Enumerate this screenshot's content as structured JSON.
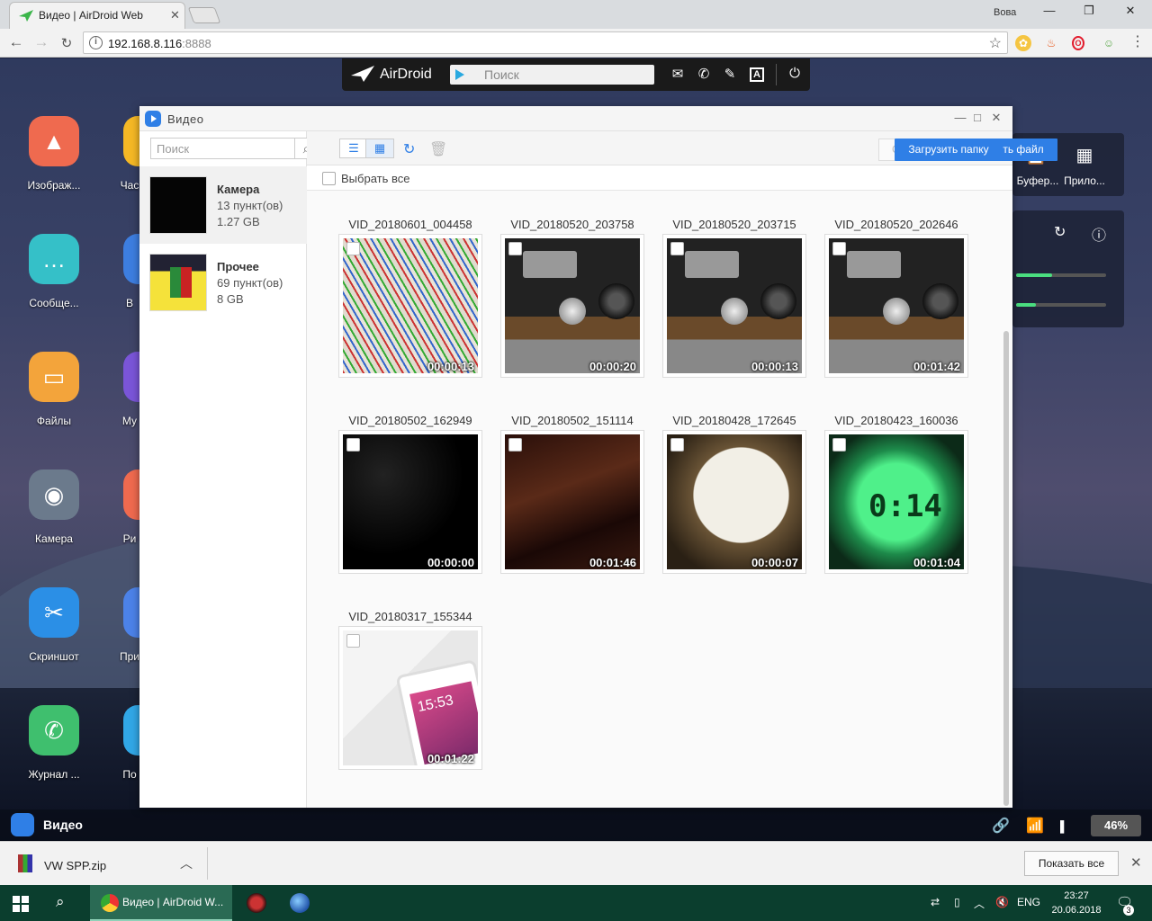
{
  "browser": {
    "tab_title": "Видео | AirDroid Web",
    "profile": "Вова",
    "url_host": "192.168.8.116",
    "url_port": ":8888"
  },
  "airdroid": {
    "brand": "AirDroid",
    "search_placeholder": "Поиск",
    "apps_left": [
      {
        "label": "Изображ...",
        "color": "#ef6a4f",
        "icon": "image-icon"
      },
      {
        "label": "Сообще...",
        "color": "#35c0c8",
        "icon": "message-icon"
      },
      {
        "label": "Файлы",
        "color": "#f3a43b",
        "icon": "folder-icon"
      },
      {
        "label": "Камера",
        "color": "#6b7a8c",
        "icon": "camera-icon"
      },
      {
        "label": "Скриншот",
        "color": "#2b8fe6",
        "icon": "scissors-icon"
      },
      {
        "label": "Журнал ...",
        "color": "#3fbf6e",
        "icon": "phone-icon"
      }
    ],
    "apps_right": [
      {
        "label": "Час",
        "color": "#f5b825"
      },
      {
        "label": "В",
        "color": "#3d7ee0"
      },
      {
        "label": "Му",
        "color": "#7a55d8"
      },
      {
        "label": "Ри",
        "color": "#ef6a4f"
      },
      {
        "label": "При",
        "color": "#4c82e8"
      },
      {
        "label": "По",
        "color": "#31a7e6"
      }
    ],
    "panel": {
      "clipboard": "Буфер...",
      "apps": "Прило..."
    },
    "bars": [
      0.4,
      0.22
    ],
    "task_app": "Видео",
    "battery": "46%"
  },
  "window": {
    "title": "Видео",
    "search_placeholder": "Поиск",
    "download_label": "Скачать",
    "upload_file_label": "Загрузить файл",
    "upload_folder_label": "Загрузить папку",
    "select_all_label": "Выбрать все",
    "albums": [
      {
        "name": "Камера",
        "count": "13 пункт(ов)",
        "size": "1.27 GB"
      },
      {
        "name": "Прочее",
        "count": "69 пункт(ов)",
        "size": "8 GB"
      }
    ],
    "videos": [
      {
        "name": "VID_20180601_004458",
        "duration": "00:00:13",
        "thumb": "wires"
      },
      {
        "name": "VID_20180520_203758",
        "duration": "00:00:20",
        "thumb": "radio"
      },
      {
        "name": "VID_20180520_203715",
        "duration": "00:00:13",
        "thumb": "radio"
      },
      {
        "name": "VID_20180520_202646",
        "duration": "00:01:42",
        "thumb": "radio"
      },
      {
        "name": "VID_20180502_162949",
        "duration": "00:00:00",
        "thumb": "dark"
      },
      {
        "name": "VID_20180502_151114",
        "duration": "00:01:46",
        "thumb": "brown"
      },
      {
        "name": "VID_20180428_172645",
        "duration": "00:00:07",
        "thumb": "lamp"
      },
      {
        "name": "VID_20180423_160036",
        "duration": "00:01:04",
        "thumb": "clock"
      },
      {
        "name": "VID_20180317_155344",
        "duration": "00:01:22",
        "thumb": "phone"
      }
    ],
    "clock_thumb_text": "0:14",
    "phone_thumb_text": "15:53"
  },
  "download_bar": {
    "file": "VW SPP.zip",
    "show_all": "Показать все"
  },
  "taskbar": {
    "chrome_title": "Видео | AirDroid W...",
    "lang": "ENG",
    "time": "23:27",
    "date": "20.06.2018",
    "notif_count": "3"
  }
}
